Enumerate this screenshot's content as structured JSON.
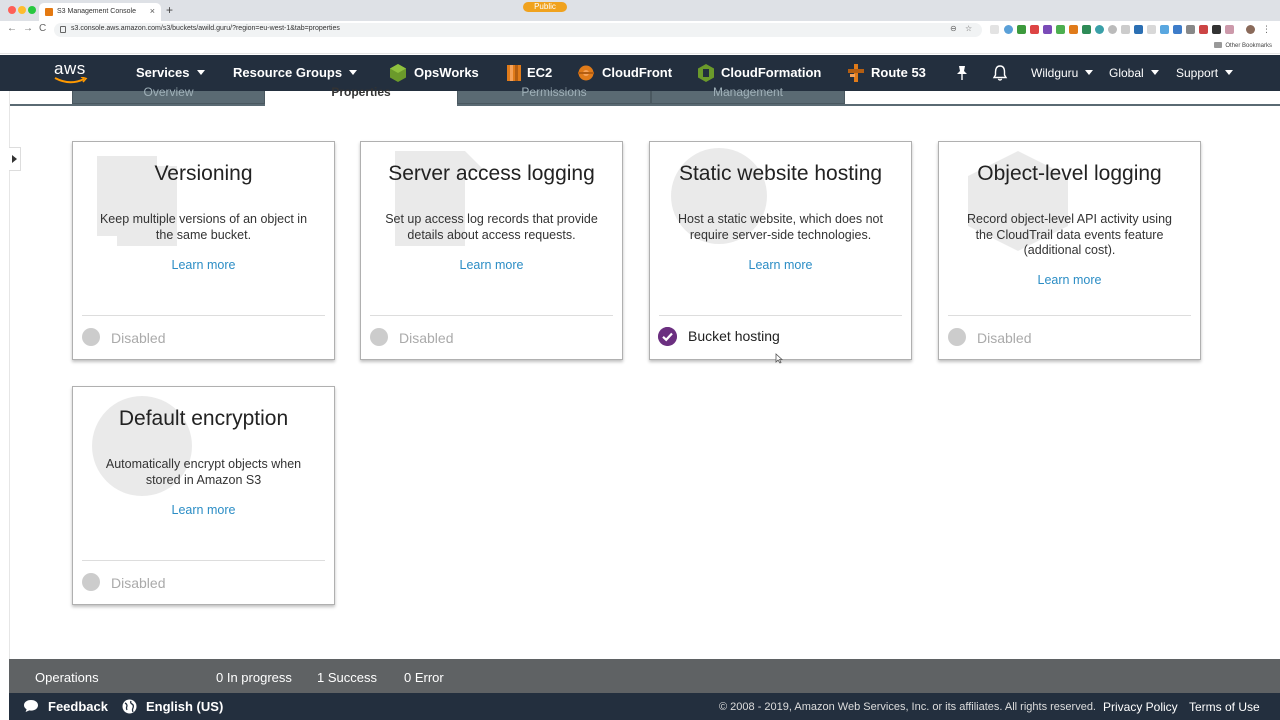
{
  "browser": {
    "tab_title": "S3 Management Console",
    "tab_close": "×",
    "new_tab": "+",
    "url": "s3.console.aws.amazon.com/s3/buckets/awild.guru/?region=eu-west-1&tab=properties",
    "back": "←",
    "forward": "→",
    "reload": "C",
    "zoom_glyph": "⊖",
    "star_glyph": "☆",
    "other_bookmarks": "Other Bookmarks"
  },
  "navbar": {
    "logo": "aws",
    "services": "Services",
    "resource_groups": "Resource Groups",
    "shortcuts": [
      {
        "label": "OpsWorks",
        "color": "#6b9a2b"
      },
      {
        "label": "EC2",
        "color": "#e07b1a"
      },
      {
        "label": "CloudFront",
        "color": "#e07b1a"
      },
      {
        "label": "CloudFormation",
        "color": "#6b9a2b"
      },
      {
        "label": "Route 53",
        "color": "#e07b1a"
      }
    ],
    "user": "Wildguru",
    "region": "Global",
    "support": "Support"
  },
  "tabs": {
    "overview": "Overview",
    "properties": "Properties",
    "permissions": "Permissions",
    "permissions_badge": "Public",
    "management": "Management"
  },
  "cards": [
    {
      "title": "Versioning",
      "desc": "Keep multiple versions of an object in the same bucket.",
      "learn": "Learn more",
      "status": "Disabled"
    },
    {
      "title": "Server access logging",
      "desc": "Set up access log records that provide details about access requests.",
      "learn": "Learn more",
      "status": "Disabled"
    },
    {
      "title": "Static website hosting",
      "desc": "Host a static website, which does not require server-side technologies.",
      "learn": "Learn more",
      "status": "Bucket hosting"
    },
    {
      "title": "Object-level logging",
      "desc": "Record object-level API activity using the CloudTrail data events feature (additional cost).",
      "learn": "Learn more",
      "status": "Disabled"
    },
    {
      "title": "Default encryption",
      "desc": "Automatically encrypt objects when stored in Amazon S3",
      "learn": "Learn more",
      "status": "Disabled"
    }
  ],
  "operations": {
    "label": "Operations",
    "in_progress": "0 In progress",
    "success": "1 Success",
    "error": "0 Error"
  },
  "footer": {
    "feedback": "Feedback",
    "language": "English (US)",
    "copyright": "© 2008 - 2019, Amazon Web Services, Inc. or its affiliates. All rights reserved.",
    "privacy": "Privacy Policy",
    "terms": "Terms of Use"
  },
  "colors": {
    "navbar_bg": "#232f3e",
    "link": "#2b8dc5",
    "enabled_check": "#6b2f80",
    "badge": "#f0a21e"
  }
}
